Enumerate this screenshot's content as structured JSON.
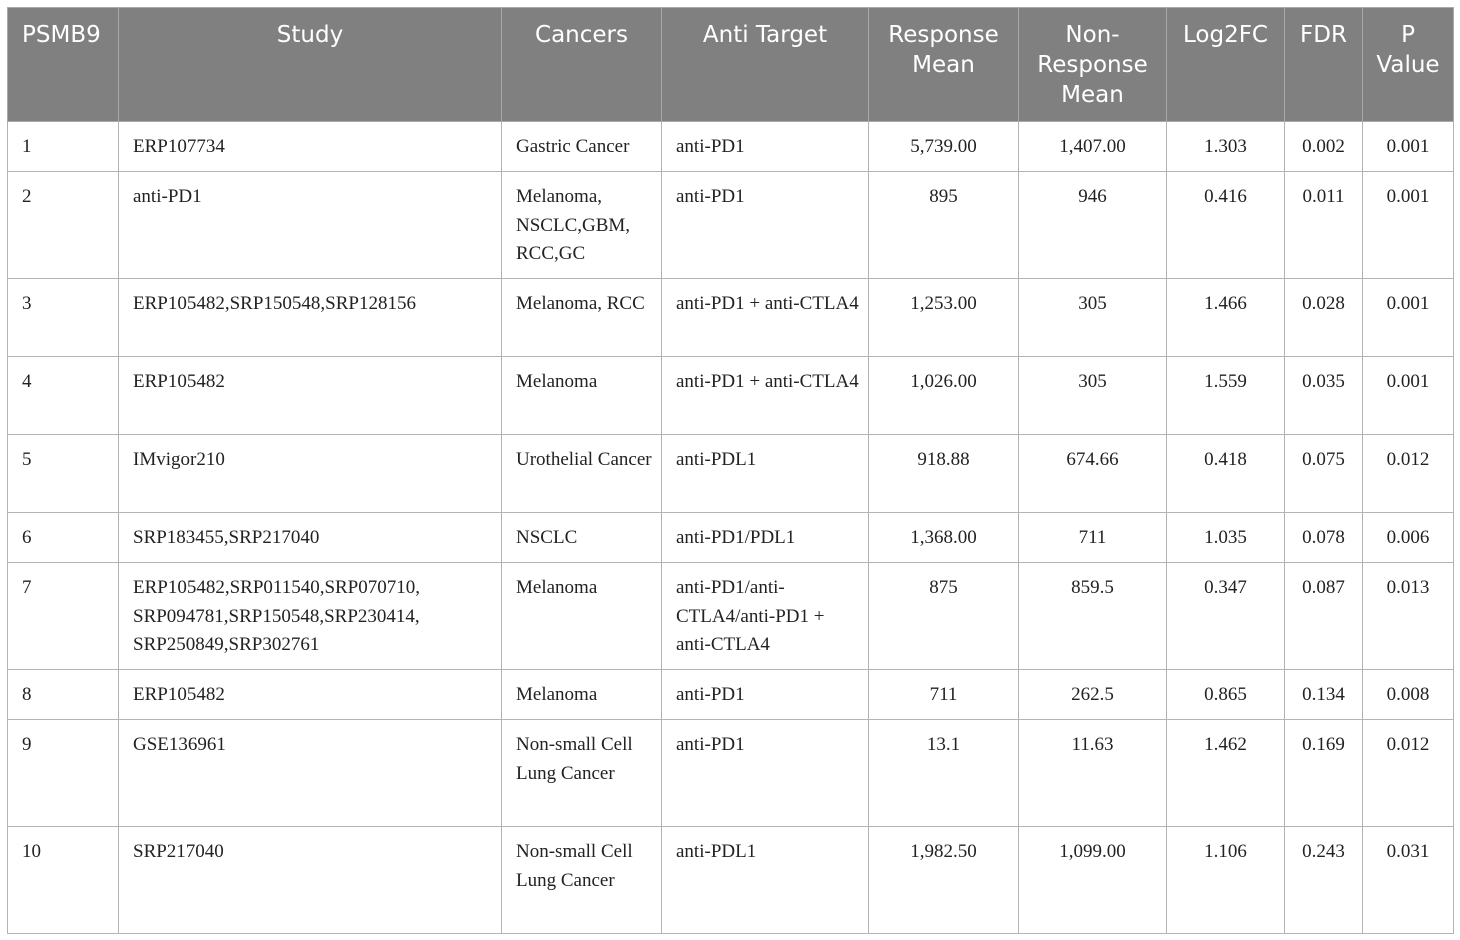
{
  "table": {
    "headers": [
      {
        "label": "PSMB9"
      },
      {
        "label": "Study"
      },
      {
        "label": "Cancers"
      },
      {
        "label": "Anti Target"
      },
      {
        "label": "Response Mean"
      },
      {
        "label": "Non-Response Mean"
      },
      {
        "label": "Log2FC"
      },
      {
        "label": "FDR"
      },
      {
        "label": "P Value"
      }
    ],
    "rows": [
      {
        "id": "1",
        "study": "ERP107734",
        "cancers": "Gastric Cancer",
        "target": "anti-PD1",
        "response_mean": "5,739.00",
        "nonresponse_mean": "1,407.00",
        "log2fc": "1.303",
        "fdr": "0.002",
        "pvalue": "0.001"
      },
      {
        "id": "2",
        "study": "anti-PD1",
        "cancers": "Melanoma, NSCLC,GBM, RCC,GC",
        "target": "anti-PD1",
        "response_mean": "895",
        "nonresponse_mean": "946",
        "log2fc": "0.416",
        "fdr": "0.011",
        "pvalue": "0.001"
      },
      {
        "id": "3",
        "study": "ERP105482,SRP150548,SRP128156",
        "cancers": "Melanoma, RCC",
        "target": "anti-PD1 + anti-CTLA4",
        "response_mean": "1,253.00",
        "nonresponse_mean": "305",
        "log2fc": "1.466",
        "fdr": "0.028",
        "pvalue": "0.001"
      },
      {
        "id": "4",
        "study": "ERP105482",
        "cancers": "Melanoma",
        "target": "anti-PD1 + anti-CTLA4",
        "response_mean": "1,026.00",
        "nonresponse_mean": "305",
        "log2fc": "1.559",
        "fdr": "0.035",
        "pvalue": "0.001"
      },
      {
        "id": "5",
        "study": "IMvigor210",
        "cancers": "Urothelial Cancer",
        "target": "anti-PDL1",
        "response_mean": "918.88",
        "nonresponse_mean": "674.66",
        "log2fc": "0.418",
        "fdr": "0.075",
        "pvalue": "0.012"
      },
      {
        "id": "6",
        "study": "SRP183455,SRP217040",
        "cancers": "NSCLC",
        "target": "anti-PD1/PDL1",
        "response_mean": "1,368.00",
        "nonresponse_mean": "711",
        "log2fc": "1.035",
        "fdr": "0.078",
        "pvalue": "0.006"
      },
      {
        "id": "7",
        "study": "ERP105482,SRP011540,SRP070710, SRP094781,SRP150548,SRP230414, SRP250849,SRP302761",
        "cancers": "Melanoma",
        "target": "anti-PD1/anti-CTLA4/anti-PD1 + anti-CTLA4",
        "response_mean": "875",
        "nonresponse_mean": "859.5",
        "log2fc": "0.347",
        "fdr": "0.087",
        "pvalue": "0.013"
      },
      {
        "id": "8",
        "study": "ERP105482",
        "cancers": "Melanoma",
        "target": "anti-PD1",
        "response_mean": "711",
        "nonresponse_mean": "262.5",
        "log2fc": "0.865",
        "fdr": "0.134",
        "pvalue": "0.008"
      },
      {
        "id": "9",
        "study": "GSE136961",
        "cancers": "Non-small Cell Lung Cancer",
        "target": "anti-PD1",
        "response_mean": "13.1",
        "nonresponse_mean": "11.63",
        "log2fc": "1.462",
        "fdr": "0.169",
        "pvalue": "0.012"
      },
      {
        "id": "10",
        "study": "SRP217040",
        "cancers": "Non-small Cell Lung Cancer",
        "target": "anti-PDL1",
        "response_mean": "1,982.50",
        "nonresponse_mean": "1,099.00",
        "log2fc": "1.106",
        "fdr": "0.243",
        "pvalue": "0.031"
      }
    ]
  }
}
